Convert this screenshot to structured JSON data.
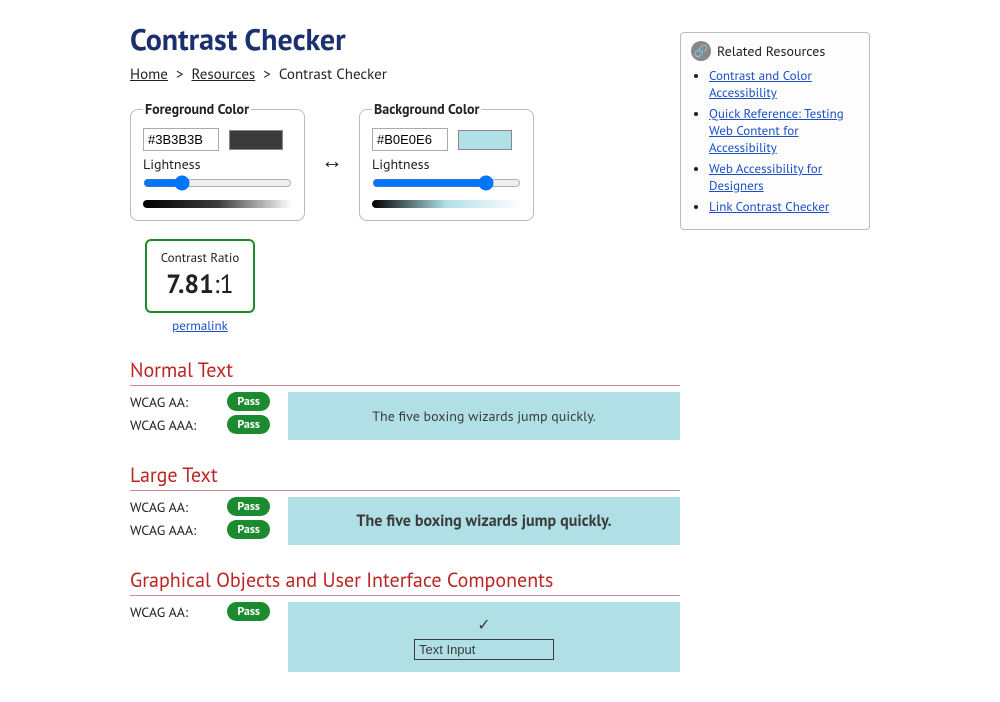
{
  "title": "Contrast Checker",
  "breadcrumb": {
    "home": "Home",
    "resources": "Resources",
    "current": "Contrast Checker"
  },
  "fg": {
    "legend": "Foreground Color",
    "hex": "#3B3B3B",
    "lightness_label": "Lightness",
    "lightness_value": "23"
  },
  "bg": {
    "legend": "Background Color",
    "hex": "#B0E0E6",
    "lightness_label": "Lightness",
    "lightness_value": "80"
  },
  "ratio": {
    "label": "Contrast Ratio",
    "bold": "7.81",
    "rest": ":1",
    "permalink": "permalink"
  },
  "sections": {
    "normal": {
      "heading": "Normal Text",
      "aa_label": "WCAG AA:",
      "aa_badge": "Pass",
      "aaa_label": "WCAG AAA:",
      "aaa_badge": "Pass",
      "sample": "The five boxing wizards jump quickly."
    },
    "large": {
      "heading": "Large Text",
      "aa_label": "WCAG AA:",
      "aa_badge": "Pass",
      "aaa_label": "WCAG AAA:",
      "aaa_badge": "Pass",
      "sample": "The five boxing wizards jump quickly."
    },
    "gui": {
      "heading": "Graphical Objects and User Interface Components",
      "aa_label": "WCAG AA:",
      "aa_badge": "Pass",
      "check": "✓",
      "input_value": "Text Input"
    }
  },
  "related": {
    "heading": "Related Resources",
    "links": [
      "Contrast and Color Accessibility",
      "Quick Reference: Testing Web Content for Accessibility",
      "Web Accessibility for Designers",
      "Link Contrast Checker"
    ]
  }
}
